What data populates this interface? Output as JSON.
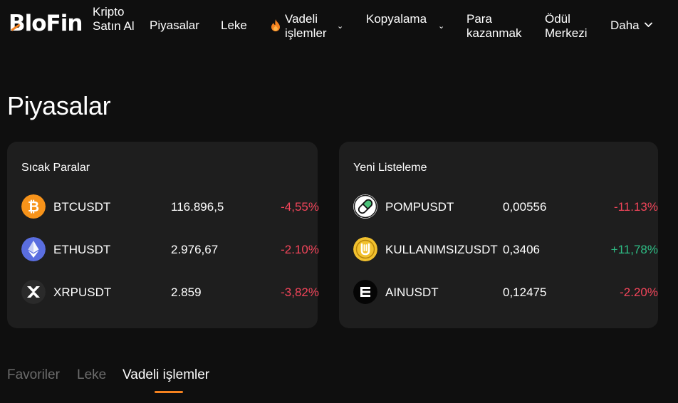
{
  "nav": {
    "logo": "BloFin",
    "items": [
      {
        "label": "Kripto Satın Al"
      },
      {
        "label": "Piyasalar"
      },
      {
        "label": "Leke"
      },
      {
        "label": "Vadeli işlemler"
      },
      {
        "label": "Kopyalama"
      },
      {
        "label": "Para kazanmak"
      },
      {
        "label": "Ödül Merkezi"
      },
      {
        "label": "Daha"
      }
    ]
  },
  "page": {
    "title": "Piyasalar"
  },
  "hot": {
    "title": "Sıcak Paralar",
    "rows": [
      {
        "symbol": "BTCUSDT",
        "price": "116.896,5",
        "change": "-4,55%",
        "icon": "bitcoin-icon"
      },
      {
        "symbol": "ETHUSDT",
        "price": "2.976,67",
        "change": "-2.10%",
        "icon": "ethereum-icon"
      },
      {
        "symbol": "XRPUSDT",
        "price": "2.859",
        "change": "-3,82%",
        "icon": "xrp-icon"
      }
    ]
  },
  "new_listing": {
    "title": "Yeni Listeleme",
    "rows": [
      {
        "symbol": "POMPUSDT",
        "price": "0,00556",
        "change": "-11.13%",
        "icon": "pill-icon"
      },
      {
        "symbol": "KULLANIMSIZUSDT",
        "price": "0,3406",
        "change": "+11,78%",
        "icon": "useless-coin-icon"
      },
      {
        "symbol": "AINUSDT",
        "price": "0,12475",
        "change": "-2.20%",
        "icon": "ain-icon"
      }
    ]
  },
  "tabs": [
    {
      "label": "Favoriler"
    },
    {
      "label": "Leke"
    },
    {
      "label": "Vadeli işlemler"
    }
  ],
  "colors": {
    "accent": "#f5821f",
    "negative": "#f2455a",
    "positive": "#2ebd85",
    "card": "#1e1e1e",
    "background": "#0f0f0f"
  }
}
